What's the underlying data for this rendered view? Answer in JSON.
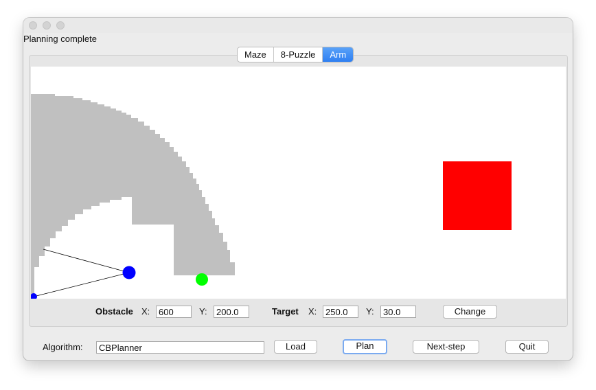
{
  "status": "Planning complete",
  "tabs": [
    {
      "label": "Maze",
      "active": false
    },
    {
      "label": "8-Puzzle",
      "active": false
    },
    {
      "label": "Arm",
      "active": true
    }
  ],
  "obstacle": {
    "label": "Obstacle",
    "x_label": "X:",
    "x_value": "600",
    "y_label": "Y:",
    "y_value": "200.0"
  },
  "target": {
    "label": "Target",
    "x_label": "X:",
    "x_value": "250.0",
    "y_label": "Y:",
    "y_value": "30.0"
  },
  "change_button": "Change",
  "algorithm": {
    "label": "Algorithm:",
    "value": "CBPlanner"
  },
  "buttons": {
    "load": "Load",
    "plan": "Plan",
    "next_step": "Next-step",
    "quit": "Quit"
  },
  "colors": {
    "obstacle": "#ff0000",
    "config_space": "#c0c0c0",
    "joint": "#0000ff",
    "goal": "#00ff00",
    "tab_active": "#2e7ff2"
  }
}
